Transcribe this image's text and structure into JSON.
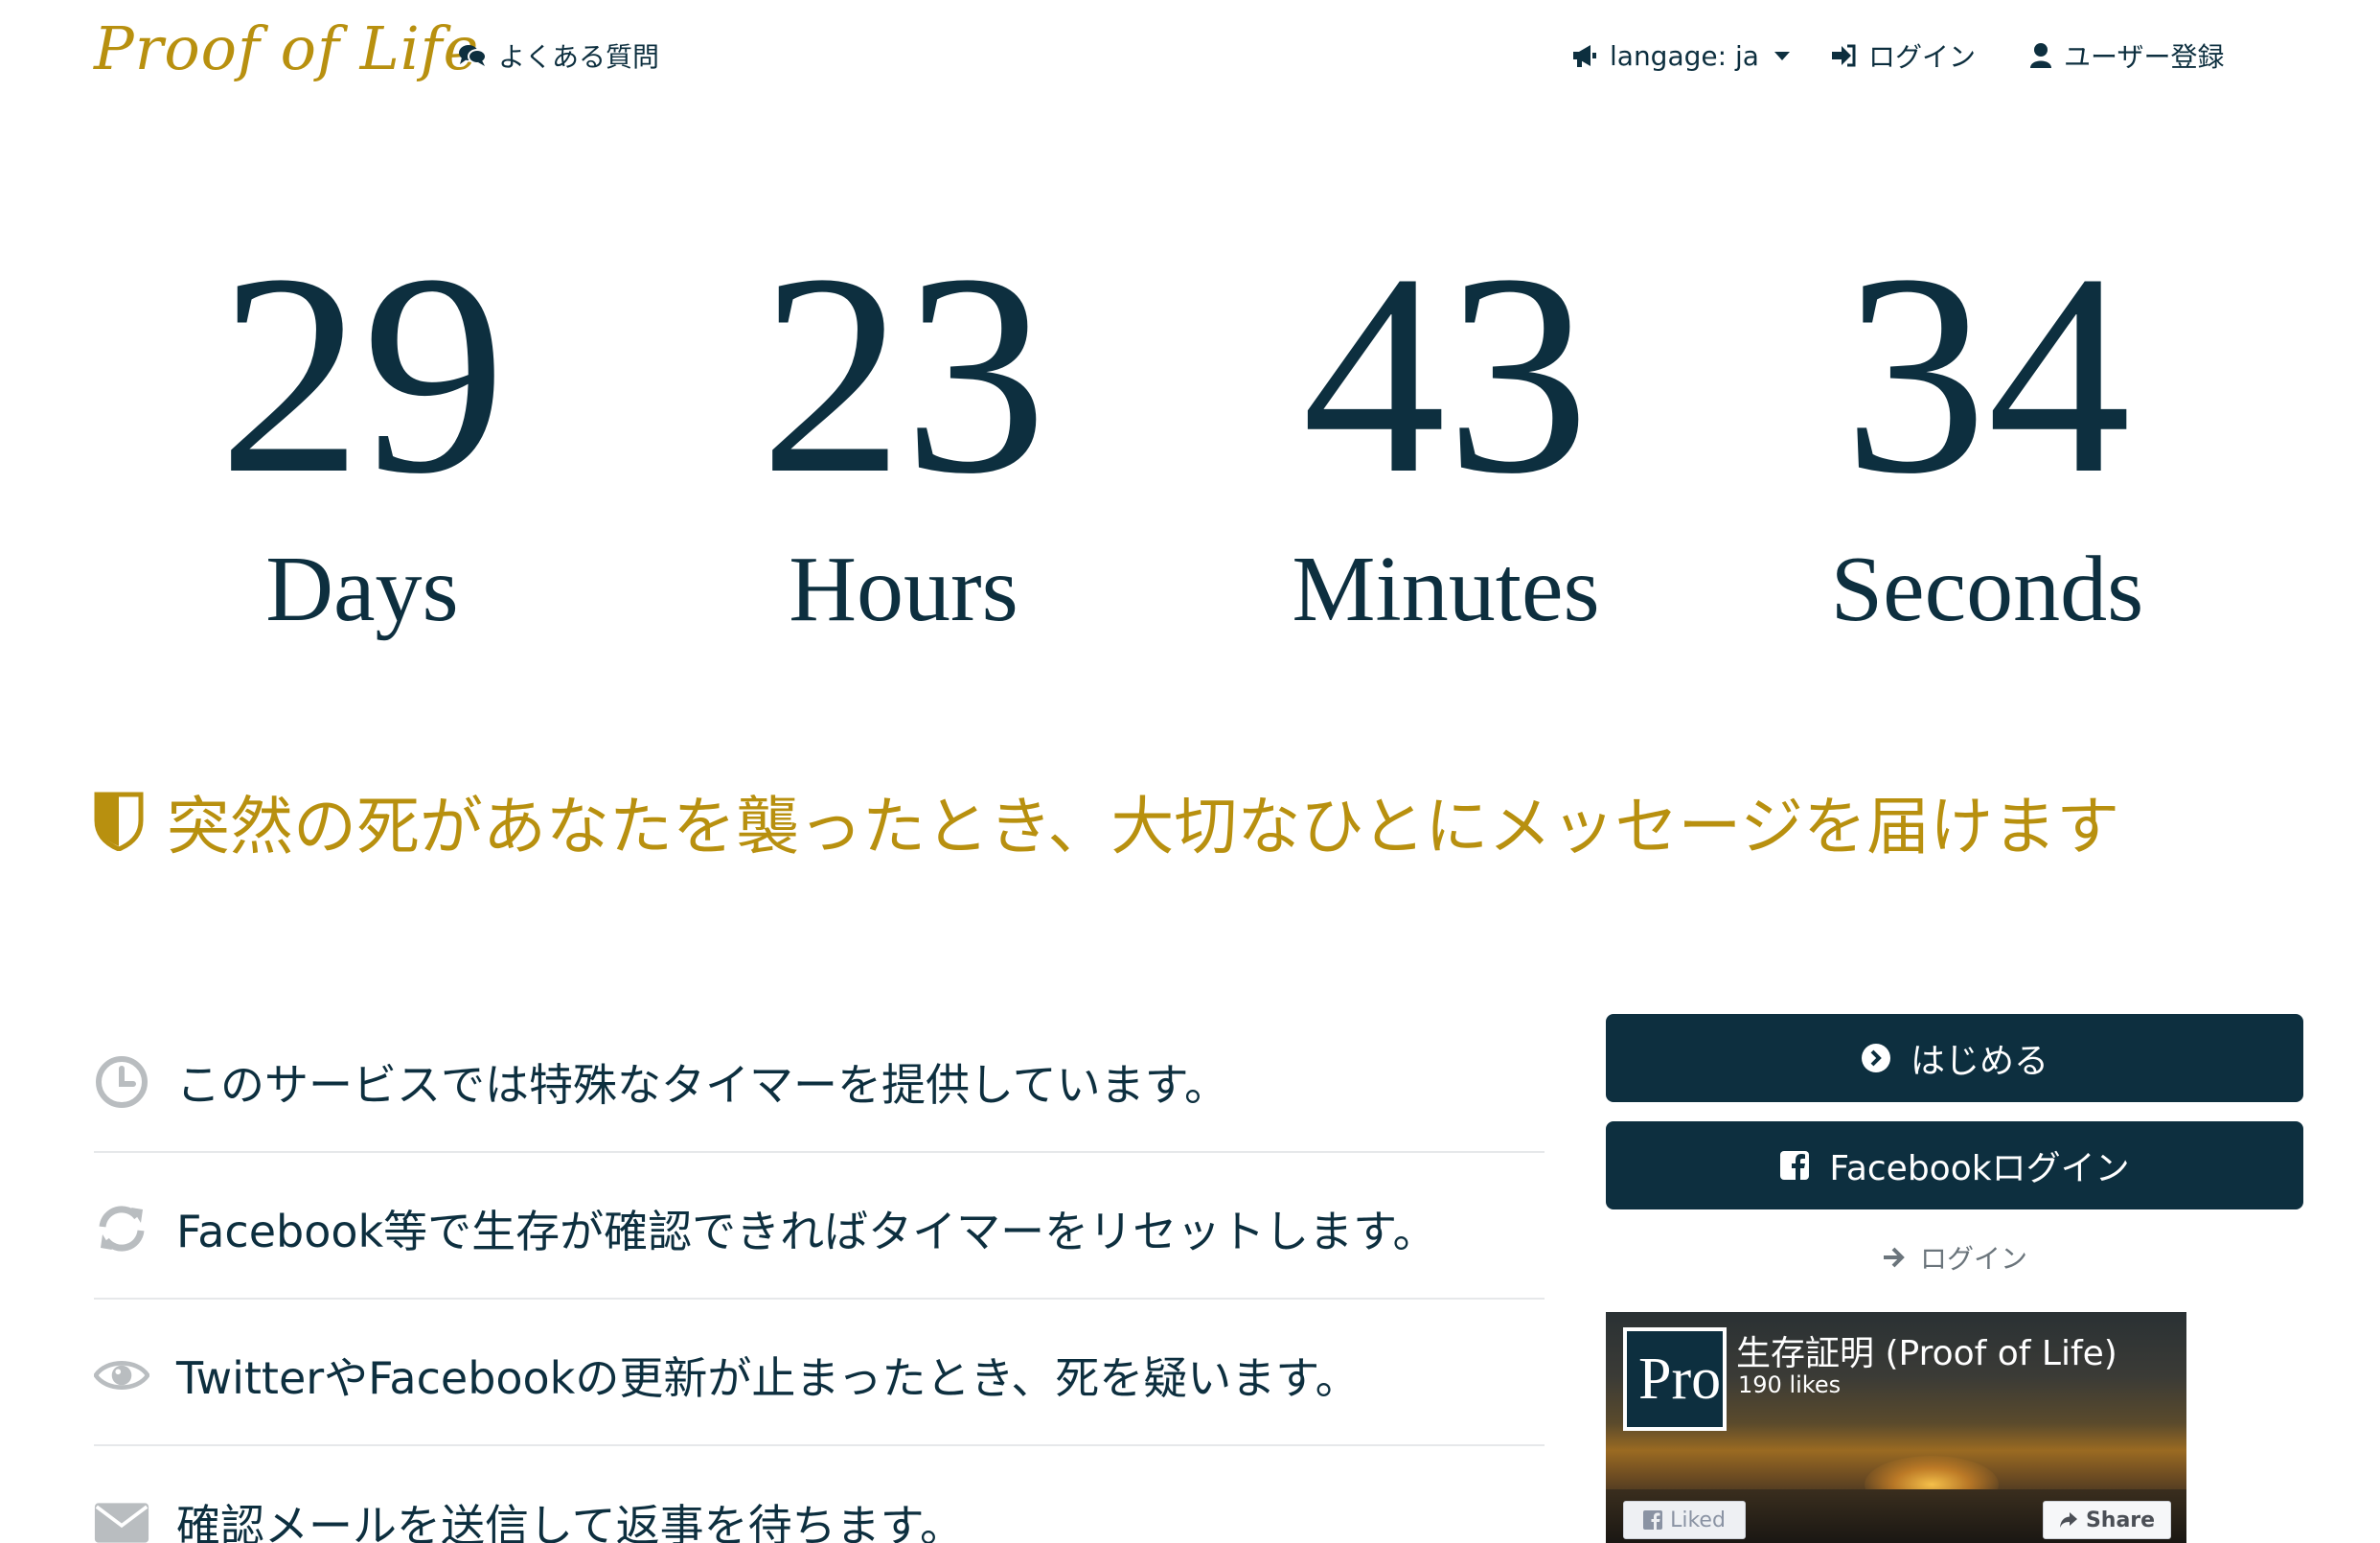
{
  "brand": "Proof of Life",
  "nav": {
    "faq": "よくある質問",
    "language": "langage: ja",
    "login": "ログイン",
    "signup": "ユーザー登録"
  },
  "countdown": [
    {
      "value": "29",
      "label": "Days"
    },
    {
      "value": "23",
      "label": "Hours"
    },
    {
      "value": "43",
      "label": "Minutes"
    },
    {
      "value": "34",
      "label": "Seconds"
    }
  ],
  "tagline": "突然の死があなたを襲ったとき、大切なひとにメッセージを届けます",
  "features": [
    {
      "icon": "clock-icon",
      "text": "このサービスでは特殊なタイマーを提供しています。"
    },
    {
      "icon": "refresh-icon",
      "text": "Facebook等で生存が確認できればタイマーをリセットします。"
    },
    {
      "icon": "eye-icon",
      "text": "TwitterやFacebookの更新が止まったとき、死を疑います。"
    },
    {
      "icon": "envelope-icon",
      "text": "確認メールを送信して返事を待ちます。"
    }
  ],
  "sidebar": {
    "start_button": "はじめる",
    "facebook_login_button": "Facebookログイン",
    "login_link": "ログイン"
  },
  "fb_widget": {
    "logo_text": "Pro",
    "page_name": "生存証明 (Proof of Life)",
    "likes": "190 likes",
    "liked_label": "Liked",
    "share_label": "Share"
  },
  "colors": {
    "navy": "#0d2f3f",
    "gold": "#b8900f",
    "divider": "#e6e8ea"
  }
}
